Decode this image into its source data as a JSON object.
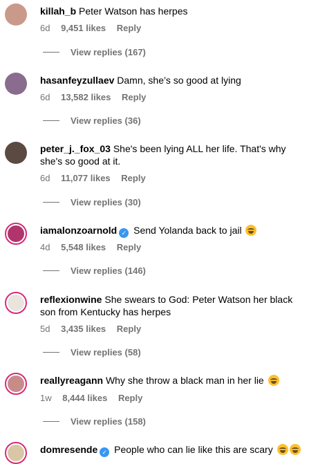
{
  "comments": [
    {
      "username": "killah_b",
      "text": "Peter Watson has herpes",
      "time": "6d",
      "likes": "9,451 likes",
      "reply": "Reply",
      "view_replies": "View replies (167)",
      "avatar_color": "#c99a8a"
    },
    {
      "username": "hasanfeyzullaev",
      "text": "Damn, she’s so good at lying",
      "time": "6d",
      "likes": "13,582 likes",
      "reply": "Reply",
      "view_replies": "View replies (36)",
      "avatar_color": "#8a6c8f"
    },
    {
      "username": "peter_j._fox_03",
      "text": "She's been lying ALL her life. That's why she's so good at it.",
      "time": "6d",
      "likes": "11,077 likes",
      "reply": "Reply",
      "view_replies": "View replies (30)",
      "avatar_color": "#5b4a42"
    },
    {
      "username": "iamalonzoarnold",
      "text": "Send Yolanda back to jail",
      "time": "4d",
      "likes": "5,548 likes",
      "reply": "Reply",
      "view_replies": "View replies (146)",
      "avatar_color": "#b0356d",
      "verified": true,
      "emoji": "laughing"
    },
    {
      "username": "reflexionwine",
      "text": "She swears to God: Peter Watson her black son from Kentucky has herpes",
      "time": "5d",
      "likes": "3,435 likes",
      "reply": "Reply",
      "view_replies": "View replies (58)",
      "avatar_color": "#e9e4dc"
    },
    {
      "username": "reallyreagann",
      "text": "Why she throw a black man in her lie",
      "time": "1w",
      "likes": "8,444 likes",
      "reply": "Reply",
      "view_replies": "View replies (158)",
      "avatar_color": "#c98a8a",
      "emoji": "laughing"
    },
    {
      "username": "domresende",
      "text": "People who can lie like this are scary",
      "avatar_color": "#d9c6a5",
      "verified": true,
      "emoji": "laughing"
    }
  ],
  "colors": {
    "secondary_text": "#737373",
    "verified_badge": "#3897f0",
    "story_ring": "#d62976"
  }
}
